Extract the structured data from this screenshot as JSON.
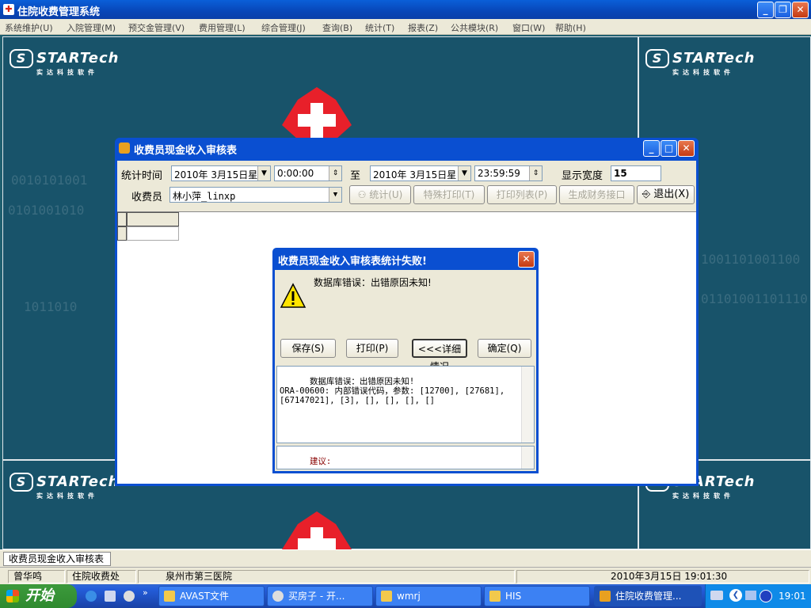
{
  "app": {
    "title": "住院收费管理系统",
    "menu": [
      "系统维护(U)",
      "入院管理(M)",
      "预交金管理(V)",
      "费用管理(L)",
      "综合管理(J)",
      "查询(B)",
      "统计(T)",
      "报表(Z)",
      "公共模块(R)",
      "窗口(W)",
      "帮助(H)"
    ]
  },
  "logo": {
    "text": "STARTech",
    "subtitle": "实达科技软件",
    "mark": "S"
  },
  "bg_digits": [
    "0010101001",
    "0101001010",
    "1011010",
    "1001101001100",
    "01101001101110"
  ],
  "child": {
    "title": "收费员现金收入审核表",
    "stat_time_label": "统计时间",
    "date_from": "2010年 3月15日星",
    "time_from": "0:00:00",
    "to_label": "至",
    "date_to": "2010年 3月15日星",
    "time_to": "23:59:59",
    "width_label": "显示宽度",
    "width_value": "15",
    "cashier_label": "收费员",
    "cashier_value": "林小萍_linxp",
    "buttons": {
      "stat": "统计(U)",
      "special_print": "特殊打印(T)",
      "print_list": "打印列表(P)",
      "gen_finance": "生成财务接口",
      "exit": "退出(X)"
    }
  },
  "dialog": {
    "title": "收费员现金收入审核表统计失败!",
    "message": "数据库错误：出错原因未知!",
    "buttons": {
      "save": "保存(S)",
      "print": "打印(P)",
      "details": "<<<详细情况",
      "ok": "确定(Q)"
    },
    "detail_text": "数据库错误：出错原因未知!\nORA-00600: 内部错误代码，参数: [12700], [27681],\n[67147021], [3], [], [], [], []",
    "suggestion_label": "建议:"
  },
  "doc_tab": "收费员现金收入审核表",
  "status": {
    "user": "曾华鸣",
    "dept": "住院收费处",
    "hospital": "泉州市第三医院",
    "datetime": "2010年3月15日 19:01:30"
  },
  "taskbar": {
    "start": "开始",
    "tasks": [
      "AVAST文件",
      "买房子 - 开...",
      "wmrj",
      "HIS",
      "住院收费管理..."
    ],
    "clock": "19:01"
  },
  "colors": {
    "desktop": "#18536a",
    "titlebar": "#0a5fd8",
    "cross": "#e8202a",
    "start": "#3c9a3c"
  }
}
